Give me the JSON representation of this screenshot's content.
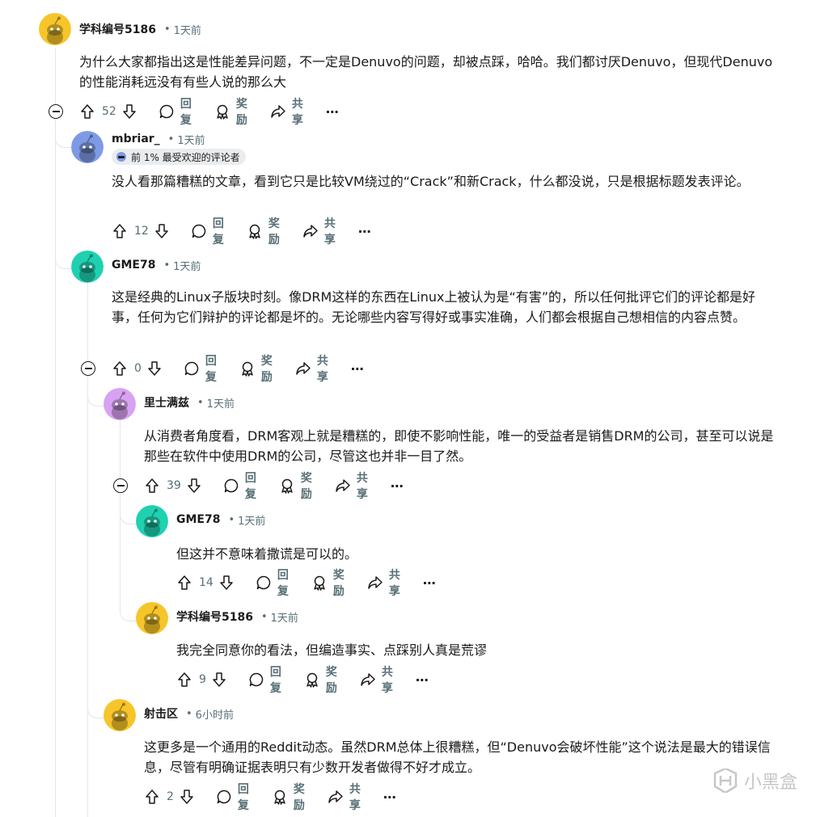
{
  "labels": {
    "reply": "回复",
    "award": "奖励",
    "share": "共享",
    "more": "⋯"
  },
  "comments": [
    {
      "username": "学科编号5186",
      "time": "1天前",
      "text": "为什么大家都指出这是性能差异问题，不一定是Denuvo的问题，却被点踩，哈哈。我们都讨厌Denuvo，但现代Denuvo的性能消耗远没有有些人说的那么大",
      "votes": "52",
      "avatar_color": "#f6c52a"
    },
    {
      "username": "mbriar_",
      "time": "1天前",
      "flair": "前 1% 最受欢迎的评论者",
      "text": "没人看那篇糟糕的文章，看到它只是比较VM绕过的“Crack”和新Crack，什么都没说，只是根据标题发表评论。",
      "votes": "12",
      "avatar_color": "#7e9ae6"
    },
    {
      "username": "GME78",
      "time": "1天前",
      "text": "这是经典的Linux子版块时刻。像DRM这样的东西在Linux上被认为是“有害”的，所以任何批评它们的评论都是好事，任何为它们辩护的评论都是坏的。无论哪些内容写得好或事实准确，人们都会根据自己想相信的内容点赞。",
      "votes": "0",
      "avatar_color": "#1fd1b1"
    },
    {
      "username": "里士满兹",
      "time": "1天前",
      "text": "从消费者角度看，DRM客观上就是糟糕的，即使不影响性能，唯一的受益者是销售DRM的公司，甚至可以说是那些在软件中使用DRM的公司，尽管这也并非一目了然。",
      "votes": "39",
      "avatar_color": "#d8a2f2"
    },
    {
      "username": "GME78",
      "time": "1天前",
      "text": "但这并不意味着撒谎是可以的。",
      "votes": "14",
      "avatar_color": "#1fd1b1"
    },
    {
      "username": "学科编号5186",
      "time": "1天前",
      "text": "我完全同意你的看法，但编造事实、点踩别人真是荒谬",
      "votes": "9",
      "avatar_color": "#f6c52a"
    },
    {
      "username": "射击区",
      "time": "6小时前",
      "text": "这更多是一个通用的Reddit动态。虽然DRM总体上很糟糕，但“Denuvo会破坏性能”这个说法是最大的错误信息，尽管有明确证据表明只有少数开发者做得不好才成立。",
      "votes": "2",
      "avatar_color": "#f6c52a"
    }
  ],
  "watermark": "小黑盒"
}
